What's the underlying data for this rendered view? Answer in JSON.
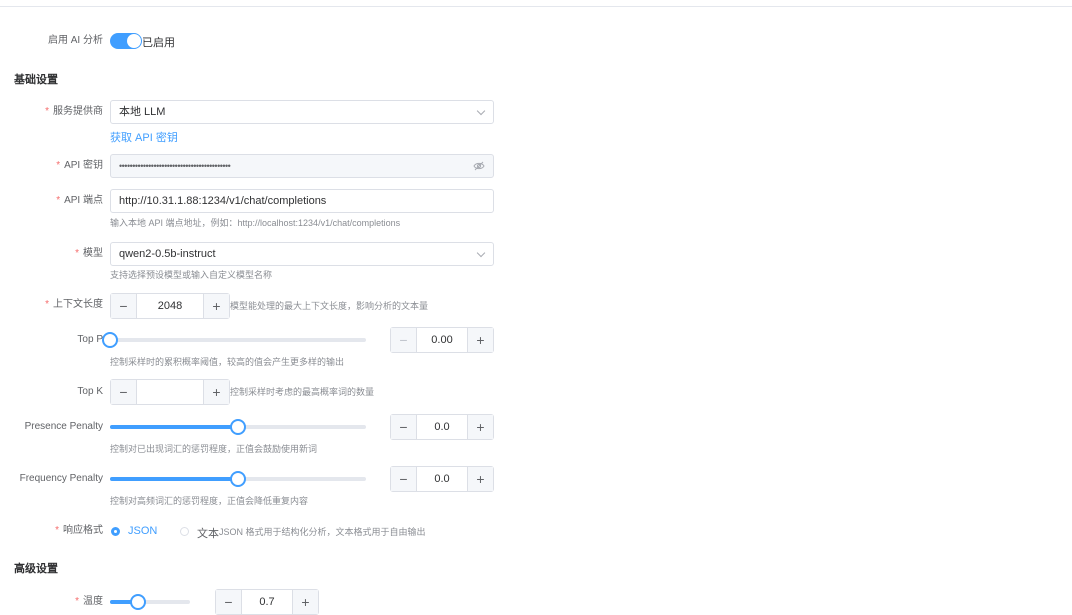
{
  "enable_ai": {
    "label": "启用 AI 分析",
    "state_text": "已启用",
    "on": true
  },
  "sections": {
    "basic": "基础设置",
    "advanced": "高级设置"
  },
  "provider": {
    "label": "服务提供商",
    "value": "本地 LLM",
    "link": "获取 API 密钥"
  },
  "api_key": {
    "label": "API 密钥",
    "value": "••••••••••••••••••••••••••••••••••••••••••"
  },
  "endpoint": {
    "label": "API 端点",
    "value": "http://10.31.1.88:1234/v1/chat/completions",
    "hint": "输入本地 API 端点地址，例如：http://localhost:1234/v1/chat/completions"
  },
  "model": {
    "label": "模型",
    "value": "qwen2-0.5b-instruct",
    "hint": "支持选择预设模型或输入自定义模型名称"
  },
  "context_length": {
    "label": "上下文长度",
    "value": "2048",
    "hint": "模型能处理的最大上下文长度，影响分析的文本量"
  },
  "top_p": {
    "label": "Top P",
    "value": "0.00",
    "level": 0.0,
    "hint": "控制采样时的累积概率阈值，较高的值会产生更多样的输出"
  },
  "top_k": {
    "label": "Top K",
    "value": "",
    "hint": "控制采样时考虑的最高概率词的数量"
  },
  "presence_penalty": {
    "label": "Presence Penalty",
    "value": "0.0",
    "level": 0.5,
    "hint": "控制对已出现词汇的惩罚程度，正值会鼓励使用新词"
  },
  "frequency_penalty": {
    "label": "Frequency Penalty",
    "value": "0.0",
    "level": 0.5,
    "hint": "控制对高频词汇的惩罚程度，正值会降低重复内容"
  },
  "response_format": {
    "label": "响应格式",
    "options": [
      "JSON",
      "文本"
    ],
    "selected": "JSON",
    "hint": "JSON 格式用于结构化分析，文本格式用于自由输出"
  },
  "temperature": {
    "label": "温度",
    "value": "0.7",
    "level": 0.35
  },
  "colors": {
    "accent": "#409eff",
    "required": "#f56c6c"
  }
}
